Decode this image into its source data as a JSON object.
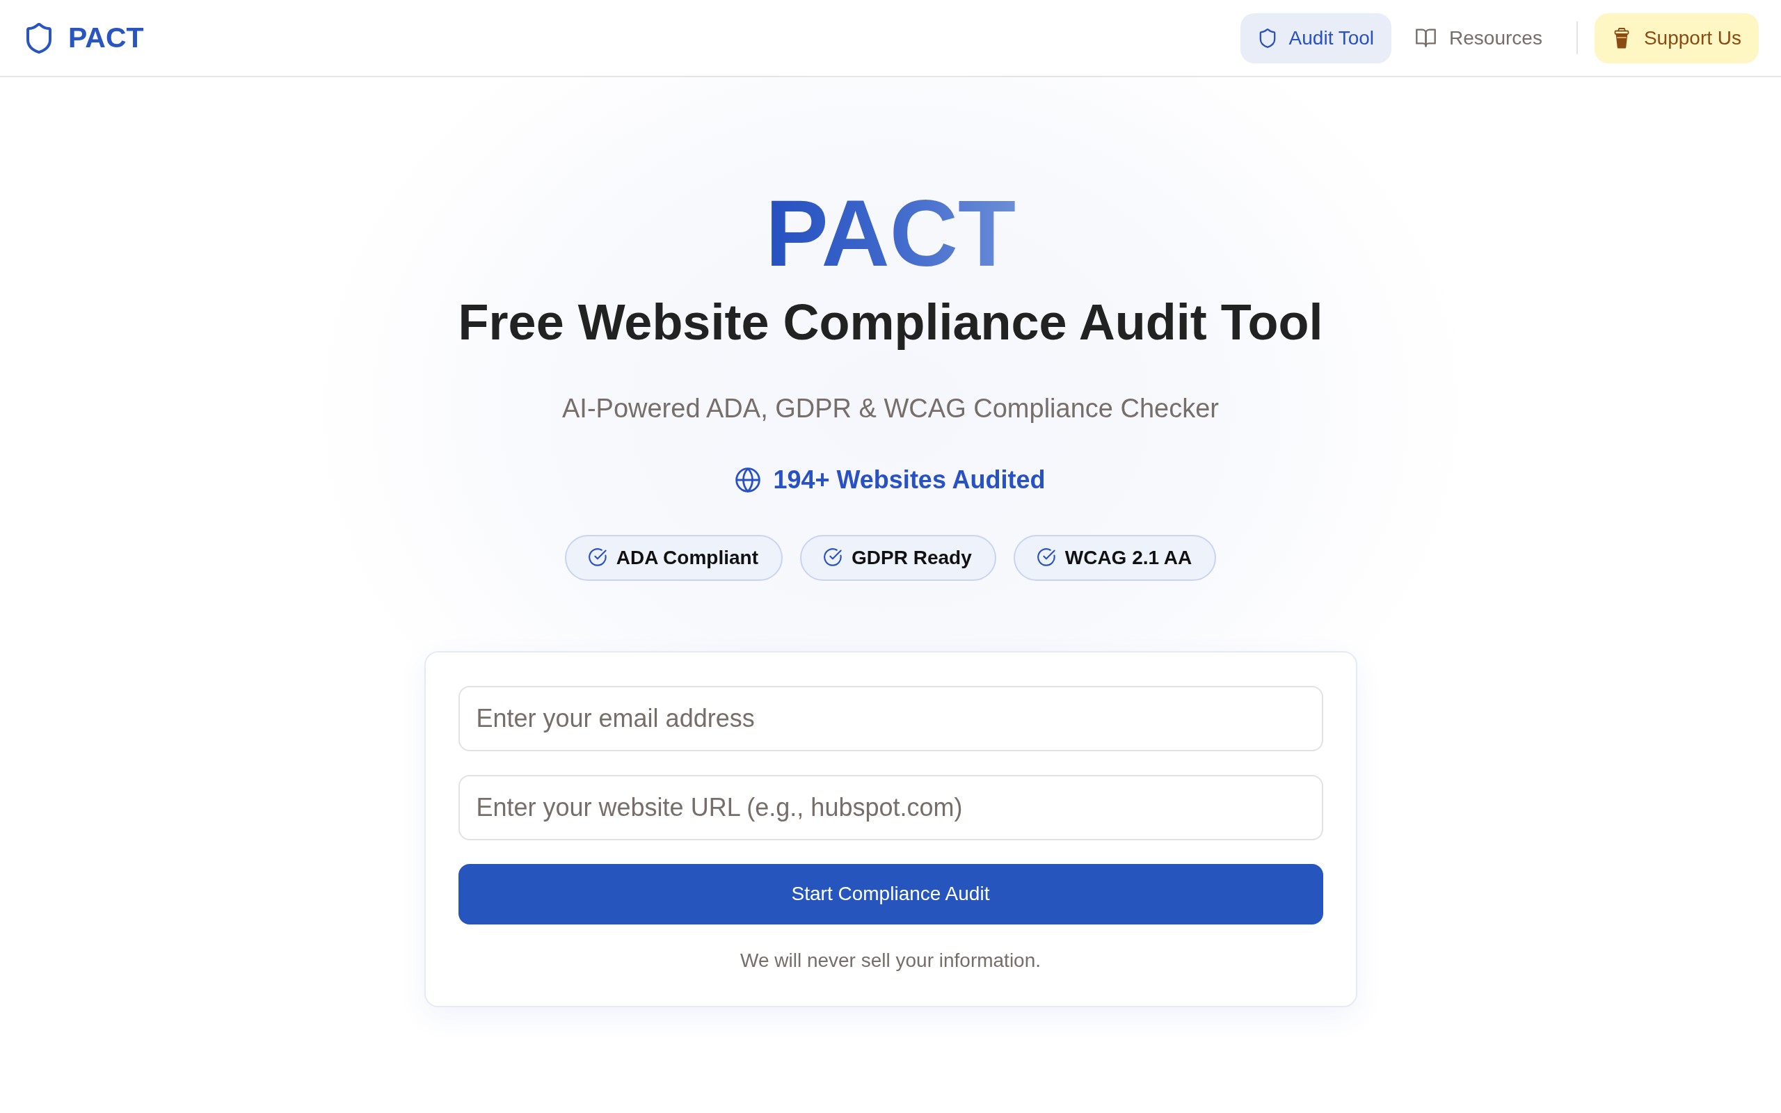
{
  "header": {
    "logo": "PACT",
    "nav": [
      {
        "label": "Audit Tool",
        "selected": true
      },
      {
        "label": "Resources",
        "selected": false
      }
    ],
    "support_button": "Support Us"
  },
  "hero": {
    "brand": "PACT",
    "title": "Free Website Compliance Audit Tool",
    "subtitle": "AI-Powered ADA, GDPR & WCAG Compliance Checker",
    "stat": "194+ Websites Audited",
    "badges": [
      "ADA Compliant",
      "GDPR Ready",
      "WCAG 2.1 AA"
    ]
  },
  "form": {
    "email": {
      "placeholder": "Enter your email address"
    },
    "url": {
      "placeholder": "Enter your website URL (e.g., hubspot.com)"
    },
    "submit": "Start Compliance Audit",
    "note": "We will never sell your information."
  }
}
